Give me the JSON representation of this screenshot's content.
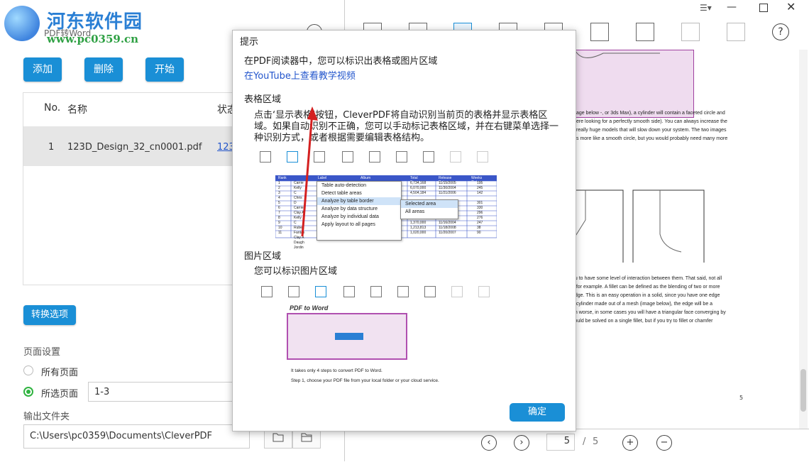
{
  "logo": {
    "title": "河东软件园",
    "url": "www.pc0359.cn",
    "subtitle": "PDF转Word"
  },
  "toolbar": {
    "add": "添加",
    "delete": "删除",
    "start": "开始"
  },
  "table": {
    "headers": {
      "no": "No.",
      "name": "名称",
      "status": "状态"
    },
    "rows": [
      {
        "no": "1",
        "name": "123D_Design_32_cn0001.pdf",
        "status": "123"
      }
    ]
  },
  "options": {
    "convert_button": "转换选项",
    "page_settings_label": "页面设置",
    "all_pages": "所有页面",
    "selected_pages": "所选页面",
    "pages_value": "1-3",
    "output_folder_label": "输出文件夹",
    "output_path": "C:\\Users\\pc0359\\Documents\\CleverPDF"
  },
  "dialog": {
    "title": "提示",
    "intro": "在PDF阅读器中，您可以标识出表格或图片区域",
    "youtube_link": "在YouTube上查看教学视频",
    "table_section_title": "表格区域",
    "table_section_text": "点击‘显示表格’按钮，CleverPDF将自动识别当前页的表格并显示表格区域。如果自动识别不正确，您可以手动标记表格区域，并在右键菜单选择一种识别方式，或者根据需要编辑表格结构。",
    "image_section_title": "图片区域",
    "image_section_text": "您可以标识图片区域",
    "ok": "确定",
    "sample_table": {
      "headers": [
        "Rank",
        "Label",
        "Album",
        "Total Scans",
        "Release Date",
        "Weeks Out"
      ],
      "rows": [
        [
          "1",
          "Carrie",
          "",
          "6,734,168",
          "11/15/2005",
          "195"
        ],
        [
          "2",
          "Kelly C",
          "",
          "6,070,000",
          "11/30/2004",
          "245"
        ],
        [
          "3",
          "Chris D",
          "",
          "4,504,184",
          "11/21/2006",
          "142"
        ],
        [
          "4",
          "Carrie",
          "",
          "",
          "",
          ""
        ],
        [
          "5",
          "Clay A",
          "",
          "",
          "",
          "301"
        ],
        [
          "6",
          "Kelly C",
          "",
          "",
          "",
          "330"
        ],
        [
          "7",
          "Ruben",
          "",
          "",
          "",
          "296"
        ],
        [
          "8",
          "Fantas",
          "",
          "",
          "",
          "276"
        ],
        [
          "9",
          "Clay A",
          "",
          "1,370,000",
          "11/16/2004",
          "247"
        ],
        [
          "10",
          "Daugh",
          "",
          "1,213,813",
          "11/18/2008",
          "38"
        ],
        [
          "11",
          "Jordin",
          "",
          "1,020,000",
          "11/20/2007",
          "90"
        ]
      ]
    },
    "context_menu": [
      "Table auto-detection",
      "Detect table areas",
      "Analyze by table border",
      "Analyze by data structure",
      "Analyze by individual data",
      "Apply layout to all pages"
    ],
    "submenu": [
      "Selected area",
      "All areas"
    ],
    "pdf_to_word": {
      "title": "PDF to Word",
      "line1": "It takes only 4 steps to convert PDF to Word.",
      "line2": "Step 1, choose your PDF file from your local folder or your cloud service."
    }
  },
  "document": {
    "text_block1": [
      "age below -, or 3ds Max), a cylinder will contain a faceted circle and",
      "ere looking for a perfectly smooth side). You can always increase the",
      "really huge models that will slow down your system. The two images",
      "s more like a smooth circle, but you would probably need many more"
    ],
    "text_block2": [
      "ou to have some level of interaction between them. That said, not all",
      "t, for example. A fillet can be defined as the blending of two or more",
      "edge. This is an easy operation in a solid, since you have one edge",
      "a cylinder made out of a mesh (image below), the edge will be a",
      "en worse, in some cases you will have a triangular face converging by",
      "could be solved on a single fillet, but if you try to fillet or chamfer"
    ],
    "page_footer": "5"
  },
  "pager": {
    "current": "5",
    "separator": "/",
    "total": "5"
  },
  "colors": {
    "accent": "#1a8fd6",
    "radio_on": "#2fb340",
    "arrow": "#d42020"
  }
}
